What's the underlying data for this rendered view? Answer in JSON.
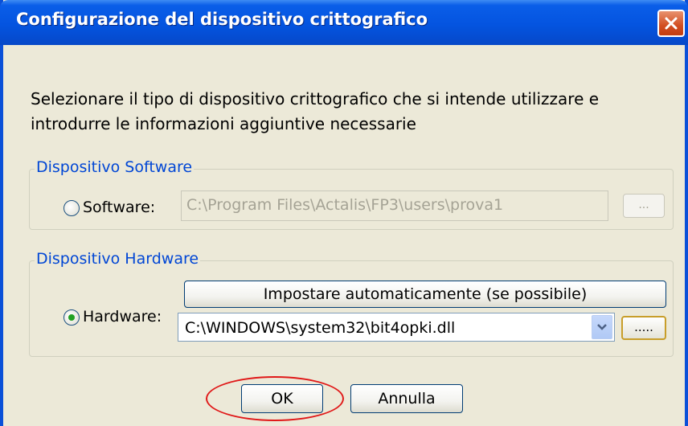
{
  "window": {
    "title": "Configurazione del dispositivo crittografico",
    "close_icon": "close-icon"
  },
  "instructions": {
    "line1": "Selezionare il tipo di dispositivo crittografico che si intende utilizzare e",
    "line2": "introdurre le informazioni aggiuntive necessarie"
  },
  "software_group": {
    "legend": "Dispositivo Software",
    "radio_label": "Software:",
    "selected": false,
    "path": "C:\\Program Files\\Actalis\\FP3\\users\\prova1",
    "browse_label": "..."
  },
  "hardware_group": {
    "legend": "Dispositivo Hardware",
    "radio_label": "Hardware:",
    "selected": true,
    "auto_button": "Impostare automaticamente (se possibile)",
    "library_value": "C:\\WINDOWS\\system32\\bit4opki.dll",
    "browse_label": "....."
  },
  "footer": {
    "ok_label": "OK",
    "cancel_label": "Annulla"
  },
  "colors": {
    "titlebar": "#0a5ee8",
    "legend_text": "#0046d5",
    "highlight": "#e01818"
  }
}
